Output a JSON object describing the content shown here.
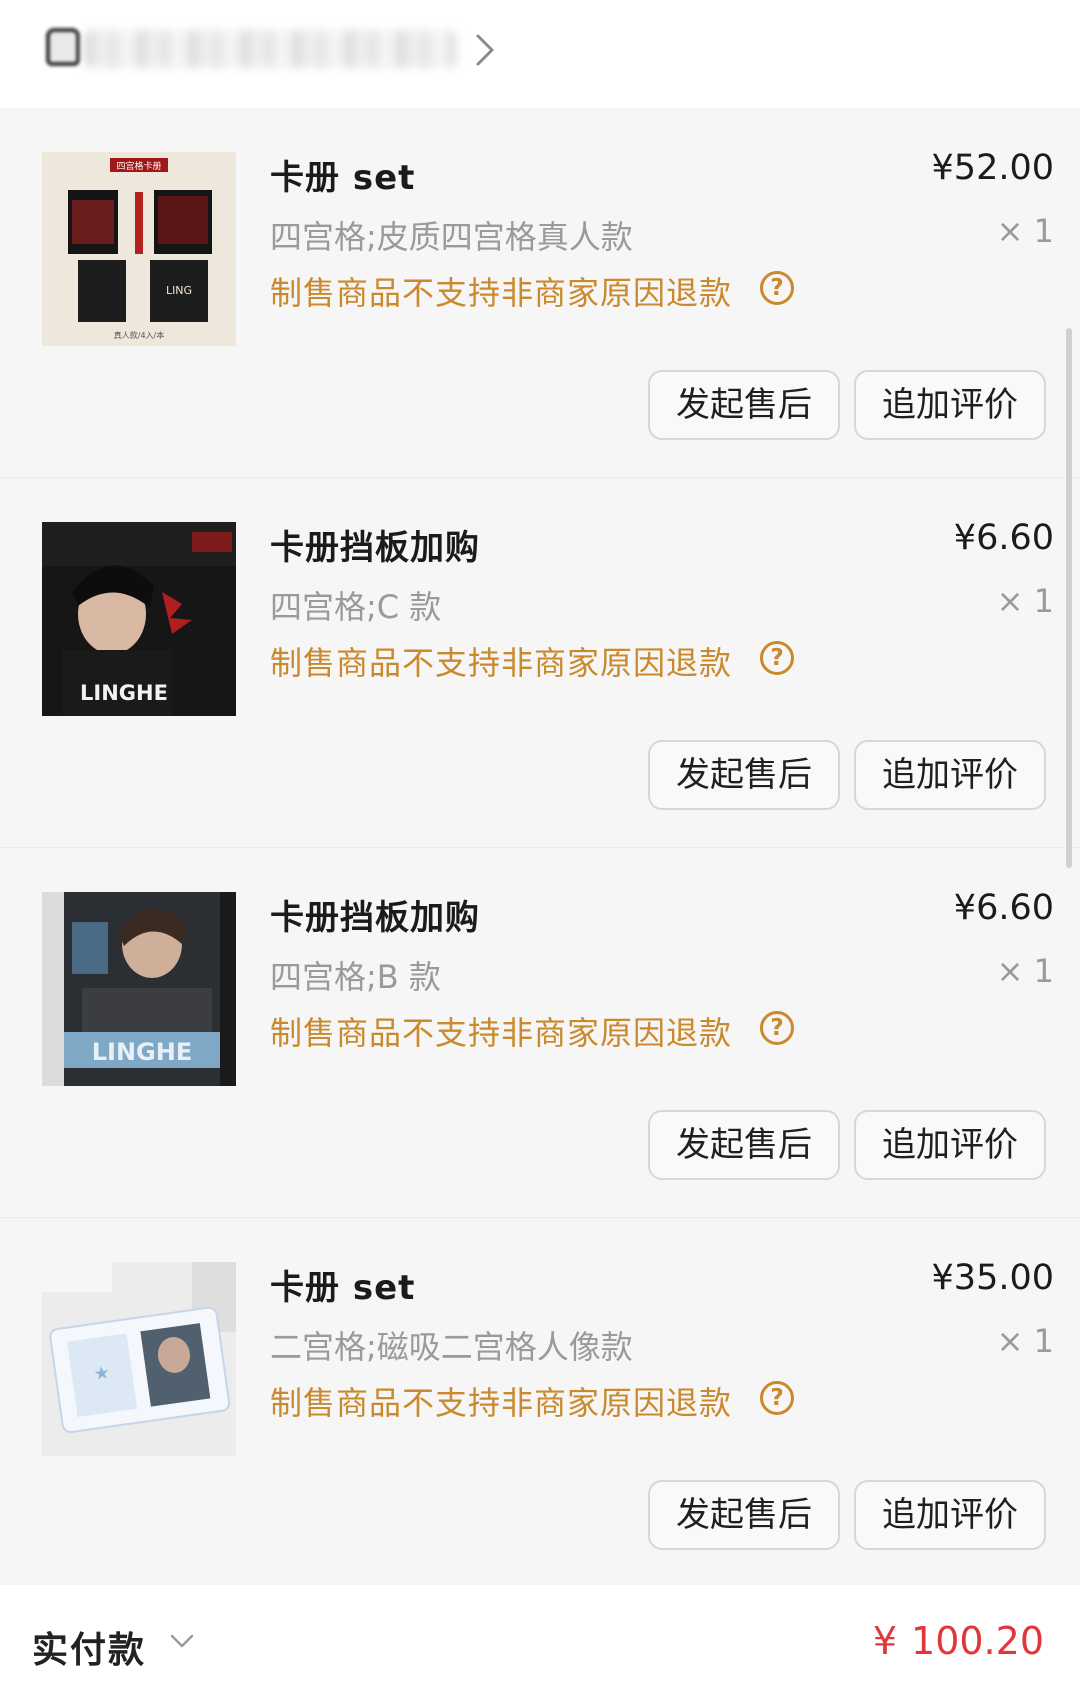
{
  "items": [
    {
      "title": "卡册 set",
      "price": "¥52.00",
      "sku": "四宫格;皮质四宫格真人款",
      "qty": "× 1",
      "notice": "制售商品不支持非商家原因退款",
      "help_icon": "question-circle-icon",
      "after_sale_label": "发起售后",
      "review_label": "追加评价",
      "thumb": {
        "label": "四宫格卡册",
        "footer": "真人款/4入/本",
        "accent": "#a01818"
      }
    },
    {
      "title": "卡册挡板加购",
      "price": "¥6.60",
      "sku": "四宫格;C 款",
      "qty": "× 1",
      "notice": "制售商品不支持非商家原因退款",
      "help_icon": "question-circle-icon",
      "after_sale_label": "发起售后",
      "review_label": "追加评价",
      "thumb": {
        "label": "LINGHE",
        "accent": "#b01e22"
      }
    },
    {
      "title": "卡册挡板加购",
      "price": "¥6.60",
      "sku": "四宫格;B 款",
      "qty": "× 1",
      "notice": "制售商品不支持非商家原因退款",
      "help_icon": "question-circle-icon",
      "after_sale_label": "发起售后",
      "review_label": "追加评价",
      "thumb": {
        "label": "LINGHE",
        "accent": "#7fa7c6"
      }
    },
    {
      "title": "卡册 set",
      "price": "¥35.00",
      "sku": "二宫格;磁吸二宫格人像款",
      "qty": "× 1",
      "notice": "制售商品不支持非商家原因退款",
      "help_icon": "question-circle-icon",
      "after_sale_label": "发起售后",
      "review_label": "追加评价",
      "thumb": {
        "label": "",
        "accent": "#8fb3d8"
      }
    }
  ],
  "footer": {
    "label": "实付款",
    "currency": "¥",
    "amount": "100.20",
    "amount_color": "#e2363d"
  },
  "colors": {
    "notice": "#c9892c",
    "background": "#f6f6f6"
  }
}
